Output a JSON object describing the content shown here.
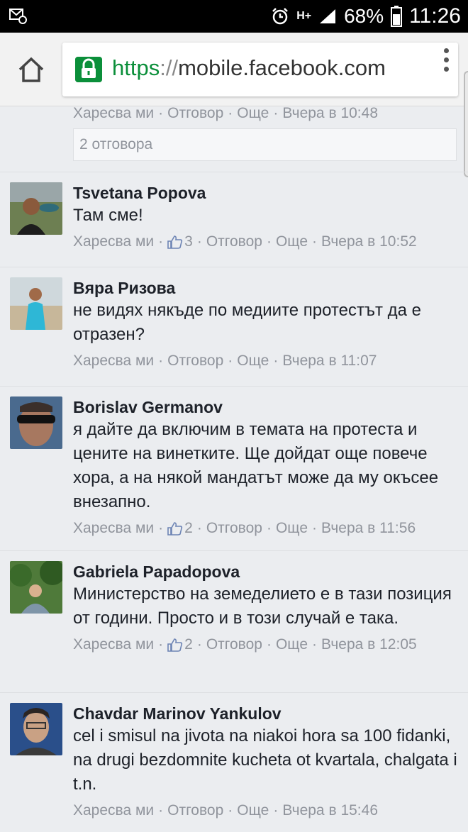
{
  "status_bar": {
    "battery": "68%",
    "time": "11:26",
    "network": "H+",
    "icons": [
      "notification-icon",
      "alarm-icon",
      "signal-icon",
      "battery-icon"
    ]
  },
  "browser": {
    "url_scheme": "https",
    "url_sep": "://",
    "url_host": "mobile.facebook.com",
    "icons": [
      "home-icon",
      "lock-icon",
      "overflow-menu-icon"
    ],
    "secure_color": "#0b8f3a"
  },
  "top_thread": {
    "like": "Харесва ми",
    "reply": "Отговор",
    "more": "Още",
    "time": "Вчера в 10:48",
    "replies_label": "2 отговора"
  },
  "comments": [
    {
      "name": "Tsvetana Popova",
      "text": "Там сме!",
      "like": "Харесва ми",
      "likes": "3",
      "reply": "Отговор",
      "more": "Още",
      "time": "Вчера в 10:52"
    },
    {
      "name": "Вяра Ризова",
      "text": "не видях някъде по медиите протестът да е отразен?",
      "like": "Харесва ми",
      "likes": "",
      "reply": "Отговор",
      "more": "Още",
      "time": "Вчера в 11:07"
    },
    {
      "name": "Borislav Germanov",
      "text": "я дайте да включим в темата на протеста и цените на винетките. Ще дойдат още повече хора, а на някой мандатът може да му окъсее внезапно.",
      "like": "Харесва ми",
      "likes": "2",
      "reply": "Отговор",
      "more": "Още",
      "time": "Вчера в 11:56"
    },
    {
      "name": "Gabriela Papadopova",
      "text": "Министерство на земеделието е в тази позиция от години. Просто и в този случай е така.",
      "like": "Харесва ми",
      "likes": "2",
      "reply": "Отговор",
      "more": "Още",
      "time": "Вчера в 12:05"
    },
    {
      "name": "Chavdar Marinov Yankulov",
      "text": "cel i smisul na jivota na niakoi hora sa 100 fidanki, na drugi bezdomnite kucheta ot kvartala, chalgata i t.n.",
      "like": "Харесва ми",
      "likes": "",
      "reply": "Отговор",
      "more": "Още",
      "time": "Вчера в 15:46"
    }
  ]
}
